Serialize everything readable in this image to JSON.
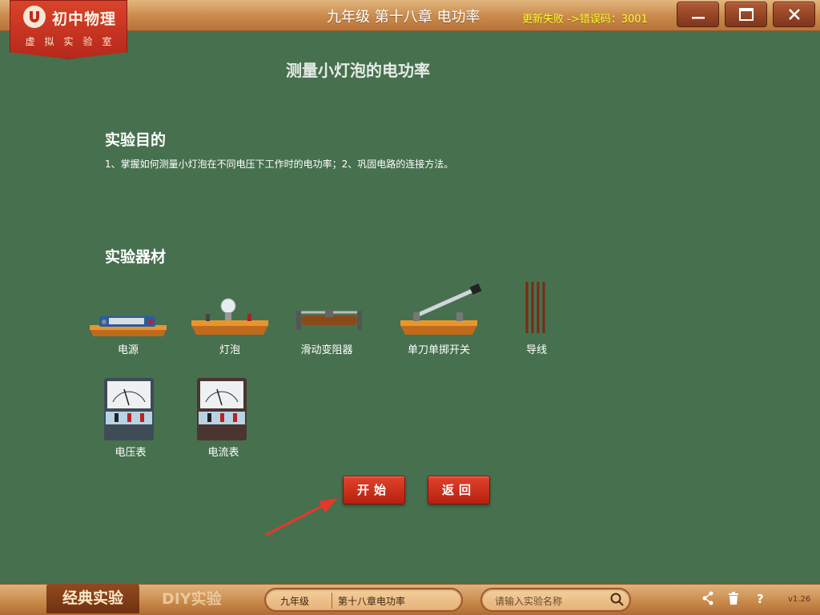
{
  "app": {
    "logo_title": "初中物理",
    "logo_subtitle": "虚拟实验室",
    "chapter_title": "九年级   第十八章 电功率",
    "update_status": "更新失败 ->错误码：3001"
  },
  "window_controls": [
    "minimize-icon",
    "maximize-icon",
    "close-icon"
  ],
  "main": {
    "title": "测量小灯泡的电功率",
    "purpose_heading": "实验目的",
    "purpose_text": "1、掌握如何测量小灯泡在不同电压下工作时的电功率；2、巩固电路的连接方法。",
    "equipment_heading": "实验器材",
    "equipment": [
      {
        "label": "电源",
        "icon": "power-supply-icon"
      },
      {
        "label": "灯泡",
        "icon": "light-bulb-icon"
      },
      {
        "label": "滑动变阻器",
        "icon": "rheostat-icon"
      },
      {
        "label": "单刀单掷开关",
        "icon": "knife-switch-icon"
      },
      {
        "label": "导线",
        "icon": "wires-icon"
      },
      {
        "label": "电压表",
        "icon": "voltmeter-icon"
      },
      {
        "label": "电流表",
        "icon": "ammeter-icon"
      }
    ],
    "start_button": "开始",
    "back_button": "返回"
  },
  "bottom": {
    "tab_classic": "经典实验",
    "tab_diy": "DIY实验",
    "grade_select": "九年级",
    "chapter_select": "第十八章电功率",
    "search_placeholder": "请输入实验名称",
    "icons": [
      "share-icon",
      "trash-icon",
      "help-icon"
    ],
    "version": "v1.26"
  },
  "colors": {
    "board": "#47704f",
    "bar": "#c9894a",
    "accent_red": "#c8301c",
    "status_yellow": "#ffff22"
  }
}
